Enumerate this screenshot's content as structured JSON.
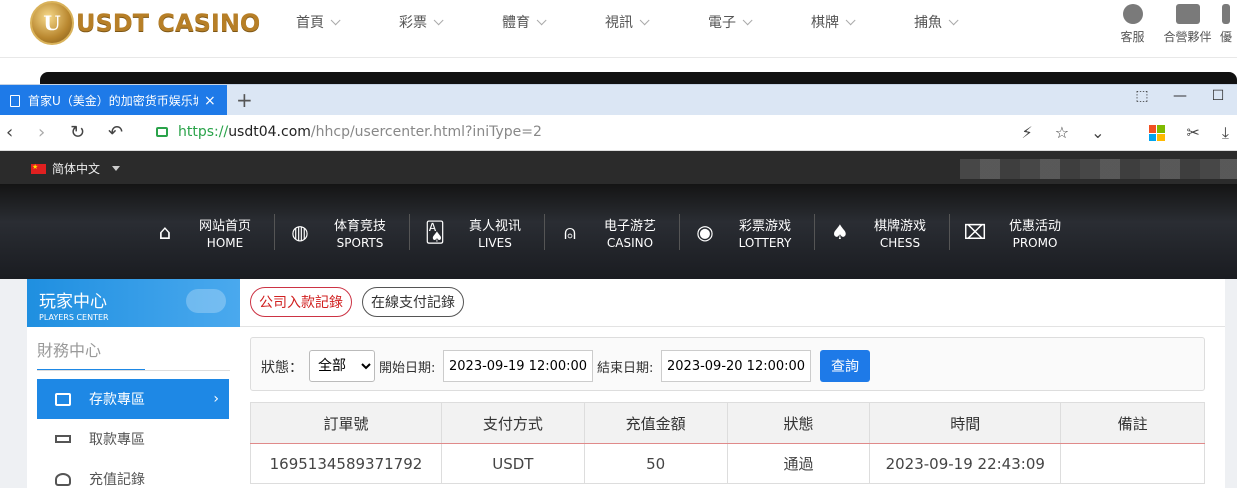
{
  "site": {
    "logo_mark": "U",
    "logo_text": "USDT CASINO",
    "nav": [
      "首頁",
      "彩票",
      "體育",
      "視訊",
      "電子",
      "棋牌",
      "捕魚"
    ],
    "tools": [
      "客服",
      "合營夥伴",
      "優"
    ]
  },
  "browser": {
    "tab_title": "首家U（美金）的加密货币娱乐城",
    "tab_close": "×",
    "new_tab": "+",
    "url_scheme": "https://",
    "url_host": "usdt04.com",
    "url_path": "/hhcp/usercenter.html?iniType=2",
    "window_controls": [
      "⬚",
      "—",
      "☐"
    ]
  },
  "lang": {
    "label": "简体中文"
  },
  "hero_nav": [
    {
      "zh": "网站首页",
      "en": "HOME",
      "icon": "home-icon",
      "glyph": "⌂"
    },
    {
      "zh": "体育竞技",
      "en": "SPORTS",
      "icon": "ball-icon",
      "glyph": "◍"
    },
    {
      "zh": "真人视讯",
      "en": "LIVES",
      "icon": "cards-icon",
      "glyph": "🂡"
    },
    {
      "zh": "电子游艺",
      "en": "CASINO",
      "icon": "joystick-icon",
      "glyph": "⍝"
    },
    {
      "zh": "彩票游戏",
      "en": "LOTTERY",
      "icon": "lottery-balls-icon",
      "glyph": "◉"
    },
    {
      "zh": "棋牌游戏",
      "en": "CHESS",
      "icon": "spade-icon",
      "glyph": "♠"
    },
    {
      "zh": "优惠活动",
      "en": "PROMO",
      "icon": "gift-icon",
      "glyph": "⌧"
    }
  ],
  "sidebar": {
    "title_zh": "玩家中心",
    "title_en": "PLAYERS CENTER",
    "section": "財務中心",
    "items": [
      {
        "label": "存款專區",
        "active": true
      },
      {
        "label": "取款專區",
        "active": false
      },
      {
        "label": "充值記錄",
        "active": false
      }
    ]
  },
  "main": {
    "tabs": [
      {
        "label": "公司入款記錄",
        "active": true
      },
      {
        "label": "在線支付記錄",
        "active": false
      }
    ],
    "filter": {
      "status_label": "狀態：",
      "status_value": "全部",
      "start_label": "開始日期:",
      "start_value": "2023-09-19 12:00:00",
      "end_label": "結束日期:",
      "end_value": "2023-09-20 12:00:00",
      "query_label": "查詢"
    },
    "table": {
      "headers": [
        "訂單號",
        "支付方式",
        "充值金額",
        "狀態",
        "時間",
        "備註"
      ],
      "rows": [
        [
          "1695134589371792",
          "USDT",
          "50",
          "通過",
          "2023-09-19 22:43:09",
          ""
        ]
      ]
    }
  },
  "colors": {
    "accent": "#1e88e5",
    "active_tab_text": "#d02020",
    "url_green": "#2aa34a"
  }
}
